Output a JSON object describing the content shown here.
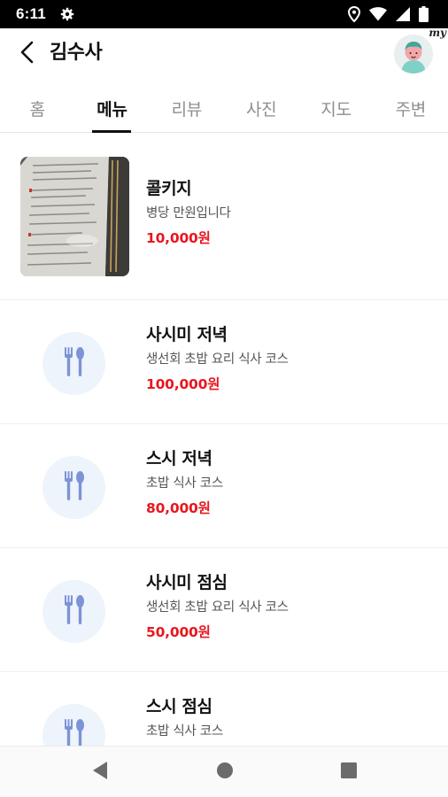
{
  "status_bar": {
    "time": "6:11",
    "left_icons": [
      "gear-icon"
    ],
    "right_icons": [
      "location-icon",
      "wifi-icon",
      "signal-icon",
      "battery-icon"
    ]
  },
  "header": {
    "title": "김수사",
    "back_icon": "chevron-left-icon",
    "avatar_badge": "my"
  },
  "tabs": [
    {
      "label": "홈",
      "active": false
    },
    {
      "label": "메뉴",
      "active": true
    },
    {
      "label": "리뷰",
      "active": false
    },
    {
      "label": "사진",
      "active": false
    },
    {
      "label": "지도",
      "active": false
    },
    {
      "label": "주변",
      "active": false
    }
  ],
  "menu_items": [
    {
      "name": "콜키지",
      "description": "병당 만원입니다",
      "price": "10,000원",
      "thumbnail": "menu-photo"
    },
    {
      "name": "사시미 저녁",
      "description": "생선회 초밥 요리 식사 코스",
      "price": "100,000원",
      "thumbnail": "utensils-icon"
    },
    {
      "name": "스시 저녁",
      "description": "초밥 식사 코스",
      "price": "80,000원",
      "thumbnail": "utensils-icon"
    },
    {
      "name": "사시미 점심",
      "description": "생선회 초밥 요리 식사 코스",
      "price": "50,000원",
      "thumbnail": "utensils-icon"
    },
    {
      "name": "스시 점심",
      "description": "초밥 식사 코스",
      "price": "",
      "thumbnail": "utensils-icon"
    }
  ],
  "colors": {
    "price": "#e8171f",
    "active_tab": "#111111",
    "inactive_tab": "#8e8e8e",
    "placeholder_bg": "#eef4fb",
    "utensil": "#7d93d6"
  },
  "nav_bar": {
    "buttons": [
      "back-triangle-icon",
      "home-circle-icon",
      "recents-square-icon"
    ]
  }
}
